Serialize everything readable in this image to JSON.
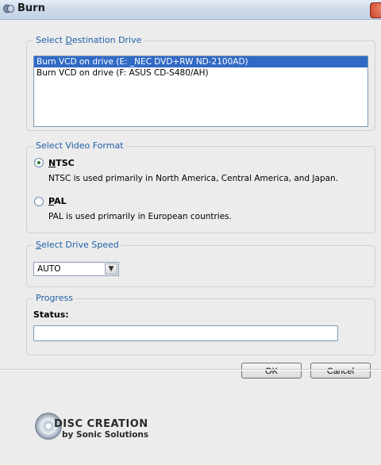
{
  "window": {
    "title": "Burn"
  },
  "destination": {
    "legend_prefix": "Select ",
    "legend_accel": "D",
    "legend_suffix": "estination Drive",
    "drives": [
      {
        "label": "Burn VCD on drive (E: _NEC  DVD+RW ND-2100AD)",
        "selected": true
      },
      {
        "label": "Burn VCD on drive (F: ASUS  CD-S480/AH)",
        "selected": false
      }
    ]
  },
  "video_format": {
    "legend": "Select Video Format",
    "options": [
      {
        "accel": "N",
        "rest": "TSC",
        "description": "NTSC is used primarily in North America, Central America, and Japan.",
        "selected": true
      },
      {
        "accel": "P",
        "rest": "AL",
        "description": "PAL is used primarily in European countries.",
        "selected": false
      }
    ]
  },
  "drive_speed": {
    "legend_accel": "S",
    "legend_rest": "elect Drive Speed",
    "value": "AUTO"
  },
  "progress": {
    "legend": "Progress",
    "status_label": "Status:",
    "status_value": ""
  },
  "buttons": {
    "ok": "OK",
    "cancel": "Cancel"
  },
  "branding": {
    "line1": "DISC CREATION",
    "line2": "by Sonic Solutions"
  },
  "colors": {
    "accent": "#1e5fa8",
    "selection": "#316ac5",
    "radio_dot": "#2d7a2d"
  }
}
